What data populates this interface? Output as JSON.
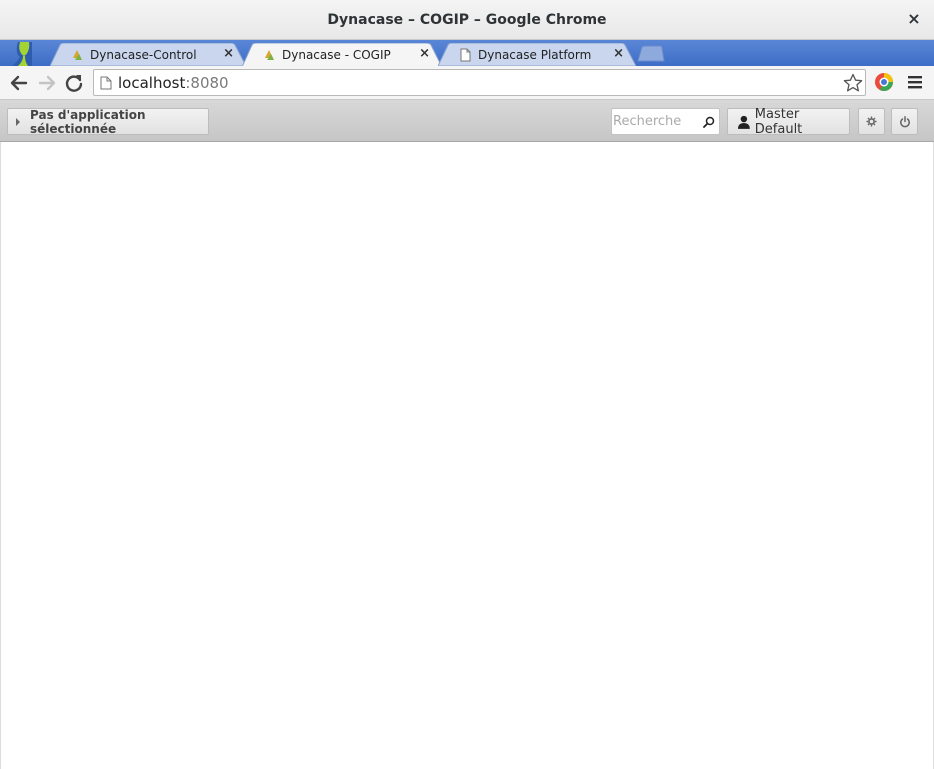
{
  "window": {
    "title": "Dynacase – COGIP – Google Chrome",
    "close_label": "×"
  },
  "tabs": [
    {
      "label": "Dynacase-Control",
      "icon": "dynacase-favicon",
      "close": "×",
      "active": false
    },
    {
      "label": "Dynacase - COGIP",
      "icon": "dynacase-favicon",
      "close": "×",
      "active": true
    },
    {
      "label": "Dynacase Platform",
      "icon": "page-icon",
      "close": "×",
      "active": false
    }
  ],
  "omnibox": {
    "host": "localhost",
    "port": ":8080"
  },
  "appbar": {
    "app_selector_label": "Pas d'application sélectionnée",
    "search_placeholder": "Recherche",
    "user_label": "Master Default"
  },
  "colors": {
    "tabstrip": "#3d6dc6",
    "active_tab": "#f5f5f5",
    "inactive_tab": "#c9d6ee",
    "appbar": "#cfcfcf"
  }
}
